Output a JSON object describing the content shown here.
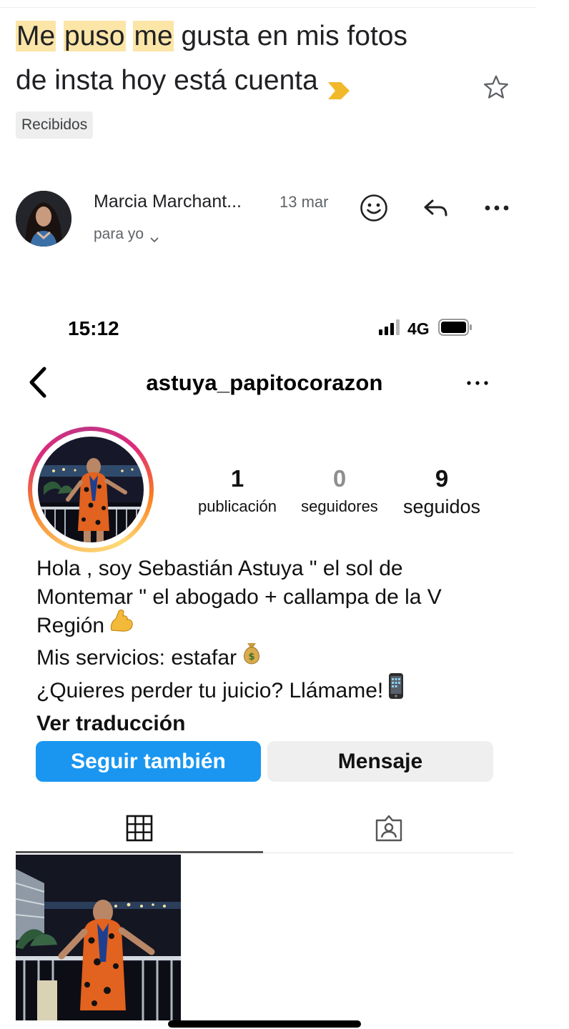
{
  "email": {
    "subject_hl_1": "Me",
    "subject_hl_2": "puso",
    "subject_hl_3": "me",
    "subject_rest_line1": "gusta en mis fotos",
    "subject_line2": "de insta hoy está cuenta",
    "label": "Recibidos",
    "sender_name": "Marcia Marchant...",
    "date": "13 mar",
    "recipient": "para yo",
    "icons": [
      "important-marker-icon",
      "star-icon",
      "emoji-reaction-icon",
      "reply-icon",
      "more-options-icon",
      "chevron-down-icon"
    ],
    "colors": {
      "highlight": "#fbe5a7",
      "important": "#f1b829",
      "chip_bg": "#eeeeee"
    }
  },
  "instagram": {
    "status_time": "15:12",
    "network": "4G",
    "username": "astuya_papitocorazon",
    "stats": {
      "posts_count": "1",
      "posts_label": "publicación",
      "followers_count": "0",
      "followers_label": "seguidores",
      "following_count": "9",
      "following_label": "seguidos"
    },
    "bio": {
      "line1": "Hola , soy Sebastián Astuya \" el sol de",
      "line2": "Montemar \" el abogado + callampa de la V",
      "line3": "Región",
      "line4": "Mis servicios: estafar",
      "line5": "¿Quieres perder tu juicio? Llámame!",
      "translate": "Ver traducción"
    },
    "follow_button": "Seguir también",
    "message_button": "Mensaje",
    "icons": [
      "signal-icon",
      "battery-icon",
      "back-chevron-icon",
      "more-icon",
      "grid-icon",
      "tagged-icon",
      "flexed-biceps-emoji",
      "money-bag-emoji",
      "mobile-phone-emoji"
    ],
    "colors": {
      "follow_blue": "#1a96f0",
      "message_gray": "#efefef"
    }
  }
}
